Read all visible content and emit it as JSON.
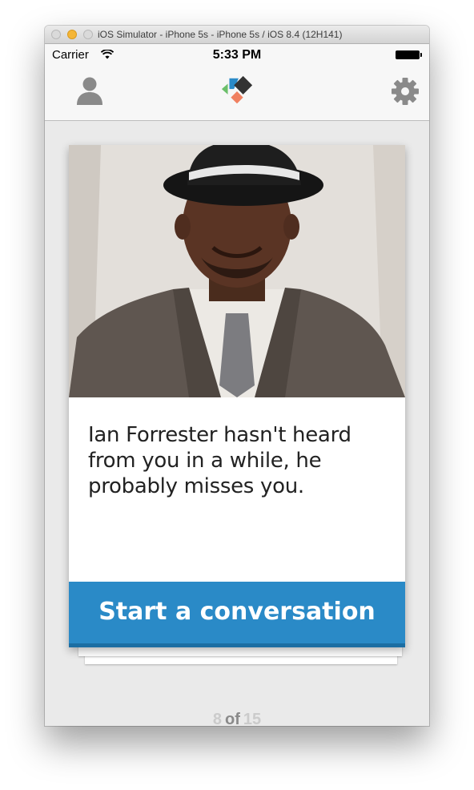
{
  "window": {
    "title": "iOS Simulator - iPhone 5s - iPhone 5s / iOS 8.4 (12H141)"
  },
  "status_bar": {
    "carrier": "Carrier",
    "time": "5:33 PM"
  },
  "nav": {
    "left_icon": "person-icon",
    "center_icon": "app-logo",
    "right_icon": "gear-icon"
  },
  "card": {
    "photo_alt": "Ian Forrester",
    "message": "Ian Forrester hasn't heard from you in a while, he probably misses you.",
    "cta_label": "Start a conversation",
    "cta_color": "#2a8ac7"
  },
  "pager": {
    "current": "8",
    "of_label": "of",
    "total": "15"
  },
  "colors": {
    "accent": "#2a8ac7",
    "logo_green": "#6bbf6a",
    "logo_blue": "#2a8ac7",
    "logo_dark": "#333333",
    "logo_orange": "#f08060"
  }
}
